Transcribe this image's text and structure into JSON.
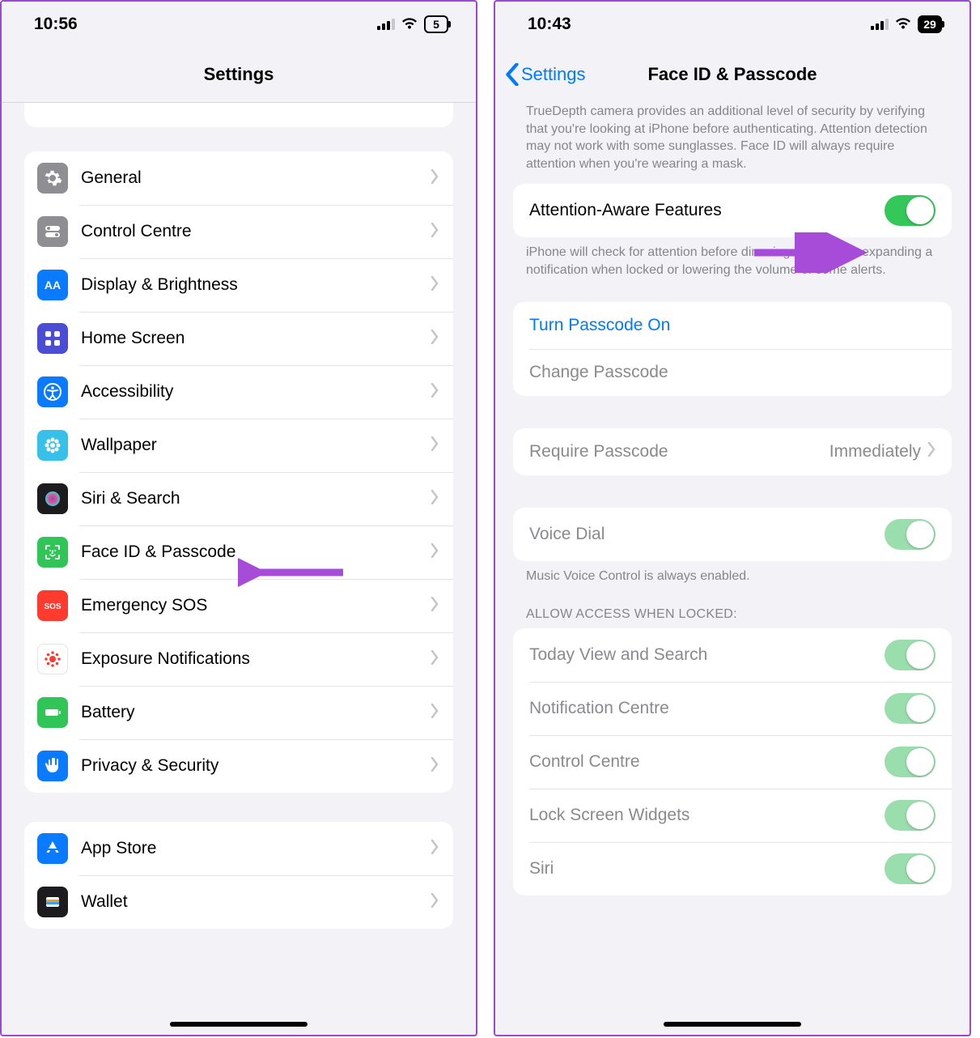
{
  "left": {
    "time": "10:56",
    "battery": "5",
    "title": "Settings",
    "group1": [
      {
        "icon": "gear",
        "bg": "#8e8e93",
        "label": "General"
      },
      {
        "icon": "switches",
        "bg": "#8e8e93",
        "label": "Control Centre"
      },
      {
        "icon": "aa",
        "bg": "#0a7aff",
        "label": "Display & Brightness"
      },
      {
        "icon": "grid",
        "bg": "#4b4dd4",
        "label": "Home Screen"
      },
      {
        "icon": "accessibility",
        "bg": "#0a7aff",
        "label": "Accessibility"
      },
      {
        "icon": "flower",
        "bg": "#37c0ea",
        "label": "Wallpaper"
      },
      {
        "icon": "siri",
        "bg": "#1c1c1e",
        "label": "Siri & Search"
      },
      {
        "icon": "faceid",
        "bg": "#31c558",
        "label": "Face ID & Passcode"
      },
      {
        "icon": "sos",
        "bg": "#ff3b30",
        "label": "Emergency SOS"
      },
      {
        "icon": "exposure",
        "bg": "#ffffff",
        "label": "Exposure Notifications"
      },
      {
        "icon": "battery",
        "bg": "#31c558",
        "label": "Battery"
      },
      {
        "icon": "hand",
        "bg": "#0a7aff",
        "label": "Privacy & Security"
      }
    ],
    "group2": [
      {
        "icon": "appstore",
        "bg": "#0a7aff",
        "label": "App Store"
      },
      {
        "icon": "wallet",
        "bg": "#1c1c1e",
        "label": "Wallet"
      }
    ]
  },
  "right": {
    "time": "10:43",
    "battery": "29",
    "back": "Settings",
    "title": "Face ID & Passcode",
    "topnote": "TrueDepth camera provides an additional level of security by verifying that you're looking at iPhone before authenticating. Attention detection may not work with some sunglasses. Face ID will always require attention when you're wearing a mask.",
    "attention_label": "Attention-Aware Features",
    "attention_note": "iPhone will check for attention before dimming the display, expanding a notification when locked or lowering the volume of some alerts.",
    "turn_on": "Turn Passcode On",
    "change": "Change Passcode",
    "require_label": "Require Passcode",
    "require_value": "Immediately",
    "voice_label": "Voice Dial",
    "voice_note": "Music Voice Control is always enabled.",
    "allow_header": "ALLOW ACCESS WHEN LOCKED:",
    "allow": [
      "Today View and Search",
      "Notification Centre",
      "Control Centre",
      "Lock Screen Widgets",
      "Siri"
    ]
  }
}
